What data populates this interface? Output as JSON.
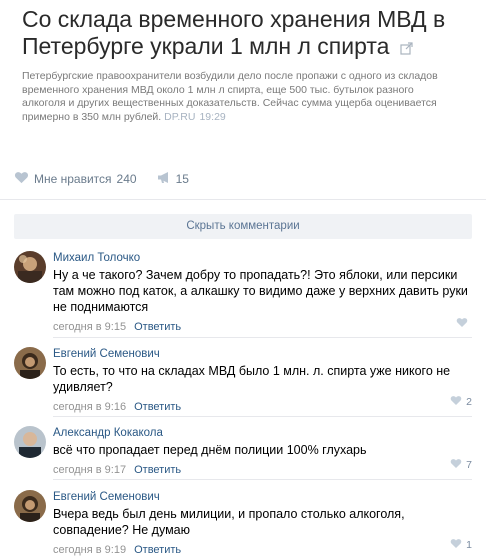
{
  "post": {
    "headline": "Со склада временного хранения МВД в Петербурге украли 1 млн л спирта",
    "excerpt": "Петербургские правоохранители возбудили дело после пропажи с одного из складов временного хранения МВД около 1 млн л спирта, еще 500 тыс. бутылок разного алкоголя и других вещественных доказательств. Сейчас сумма ущерба оценивается примерно в 350 млн рублей.",
    "source": "DP.RU",
    "time": "19:29",
    "likes_label": "Мне нравится",
    "likes_count": "240",
    "shares_count": "15"
  },
  "comments_section": {
    "hide_label": "Скрыть комментарии"
  },
  "comments": [
    {
      "author": "Михаил Толочко",
      "text": "Ну а че такого? Зачем добру то пропадать?! Это яблоки, или персики там можно под каток, а алкашку то видимо даже у верхних давить руки не поднимаются",
      "time": "сегодня в 9:15",
      "reply": "Ответить",
      "likes": ""
    },
    {
      "author": "Евгений Семенович",
      "text": "То есть, то что на складах МВД было 1 млн. л. спирта уже никого не удивляет?",
      "time": "сегодня в 9:16",
      "reply": "Ответить",
      "likes": "2"
    },
    {
      "author": "Александр Кокакола",
      "text": "всё что пропадает перед днём полиции 100% глухарь",
      "time": "сегодня в 9:17",
      "reply": "Ответить",
      "likes": "7"
    },
    {
      "author": "Евгений Семенович",
      "text": "Вчера ведь был день милиции, и пропало столько алкоголя, совпадение? Не думаю",
      "time": "сегодня в 9:19",
      "reply": "Ответить",
      "likes": "1"
    }
  ]
}
